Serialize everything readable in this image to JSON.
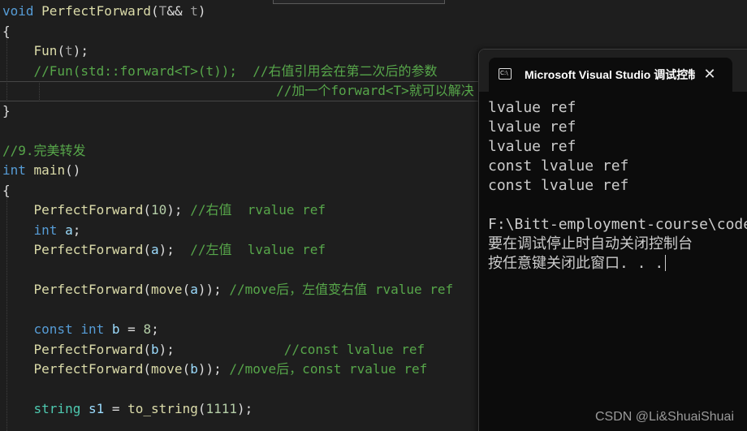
{
  "editor": {
    "lines": [
      [
        [
          "kw",
          "void"
        ],
        [
          "plain",
          " "
        ],
        [
          "fn",
          "PerfectForward"
        ],
        [
          "plain",
          "("
        ],
        [
          "param",
          "T"
        ],
        [
          "plain",
          "&& "
        ],
        [
          "param",
          "t"
        ],
        [
          "plain",
          ")"
        ]
      ],
      [
        [
          "plain",
          "{"
        ]
      ],
      [
        [
          "plain",
          "    "
        ],
        [
          "fn",
          "Fun"
        ],
        [
          "plain",
          "("
        ],
        [
          "param",
          "t"
        ],
        [
          "plain",
          ");"
        ]
      ],
      [
        [
          "plain",
          "    "
        ],
        [
          "comment",
          "//Fun(std::forward<T>(t));  //右值引用会在第二次后的参数"
        ]
      ],
      [
        [
          "plain",
          "                                   "
        ],
        [
          "comment",
          "//加一个forward<T>就可以解决"
        ]
      ],
      [
        [
          "plain",
          "}"
        ]
      ],
      [
        [
          "plain",
          ""
        ]
      ],
      [
        [
          "comment",
          "//9.完美转发"
        ]
      ],
      [
        [
          "kw",
          "int"
        ],
        [
          "plain",
          " "
        ],
        [
          "fn",
          "main"
        ],
        [
          "plain",
          "()"
        ]
      ],
      [
        [
          "plain",
          "{"
        ]
      ],
      [
        [
          "plain",
          "    "
        ],
        [
          "fn",
          "PerfectForward"
        ],
        [
          "plain",
          "("
        ],
        [
          "num",
          "10"
        ],
        [
          "plain",
          ");"
        ],
        [
          "comment",
          " //右值  rvalue ref"
        ]
      ],
      [
        [
          "plain",
          "    "
        ],
        [
          "kw",
          "int"
        ],
        [
          "plain",
          " "
        ],
        [
          "var",
          "a"
        ],
        [
          "plain",
          ";"
        ]
      ],
      [
        [
          "plain",
          "    "
        ],
        [
          "fn",
          "PerfectForward"
        ],
        [
          "plain",
          "("
        ],
        [
          "var",
          "a"
        ],
        [
          "plain",
          ");"
        ],
        [
          "comment",
          "  //左值  lvalue ref"
        ]
      ],
      [
        [
          "plain",
          ""
        ]
      ],
      [
        [
          "plain",
          "    "
        ],
        [
          "fn",
          "PerfectForward"
        ],
        [
          "plain",
          "("
        ],
        [
          "fn",
          "move"
        ],
        [
          "plain",
          "("
        ],
        [
          "var",
          "a"
        ],
        [
          "plain",
          "));"
        ],
        [
          "comment",
          " //move后，左值变右值 rvalue ref"
        ]
      ],
      [
        [
          "plain",
          ""
        ]
      ],
      [
        [
          "plain",
          "    "
        ],
        [
          "kw",
          "const"
        ],
        [
          "plain",
          " "
        ],
        [
          "kw",
          "int"
        ],
        [
          "plain",
          " "
        ],
        [
          "var",
          "b"
        ],
        [
          "plain",
          " = "
        ],
        [
          "num",
          "8"
        ],
        [
          "plain",
          ";"
        ]
      ],
      [
        [
          "plain",
          "    "
        ],
        [
          "fn",
          "PerfectForward"
        ],
        [
          "plain",
          "("
        ],
        [
          "var",
          "b"
        ],
        [
          "plain",
          ");"
        ],
        [
          "comment",
          "              //const lvalue ref"
        ]
      ],
      [
        [
          "plain",
          "    "
        ],
        [
          "fn",
          "PerfectForward"
        ],
        [
          "plain",
          "("
        ],
        [
          "fn",
          "move"
        ],
        [
          "plain",
          "("
        ],
        [
          "var",
          "b"
        ],
        [
          "plain",
          "));"
        ],
        [
          "comment",
          " //move后，const rvalue ref"
        ]
      ],
      [
        [
          "plain",
          ""
        ]
      ],
      [
        [
          "plain",
          "    "
        ],
        [
          "type",
          "string"
        ],
        [
          "plain",
          " "
        ],
        [
          "var",
          "s1"
        ],
        [
          "plain",
          " = "
        ],
        [
          "fn",
          "to_string"
        ],
        [
          "plain",
          "("
        ],
        [
          "num",
          "1111"
        ],
        [
          "plain",
          ");"
        ]
      ]
    ]
  },
  "console": {
    "title": "Microsoft Visual Studio 调试控制台",
    "app_icon": "console-app-icon",
    "app_icon_text": "C:\\",
    "close_glyph": "✕",
    "output_lines": [
      "lvalue ref",
      "lvalue ref",
      "lvalue ref",
      "const lvalue ref",
      "const lvalue ref"
    ],
    "path_line": "F:\\Bitt-employment-course\\code",
    "info_line": "要在调试停止时自动关闭控制台",
    "prompt_line": "按任意键关闭此窗口. . ."
  },
  "watermark": "CSDN @Li&ShuaiShuai",
  "colors": {
    "editor_bg": "#1e1e1e",
    "keyword": "#569cd6",
    "function": "#dcdcaa",
    "comment": "#57a64a",
    "number": "#b5cea8",
    "variable": "#9cdcfe",
    "console_bg": "#0c0c0c"
  }
}
